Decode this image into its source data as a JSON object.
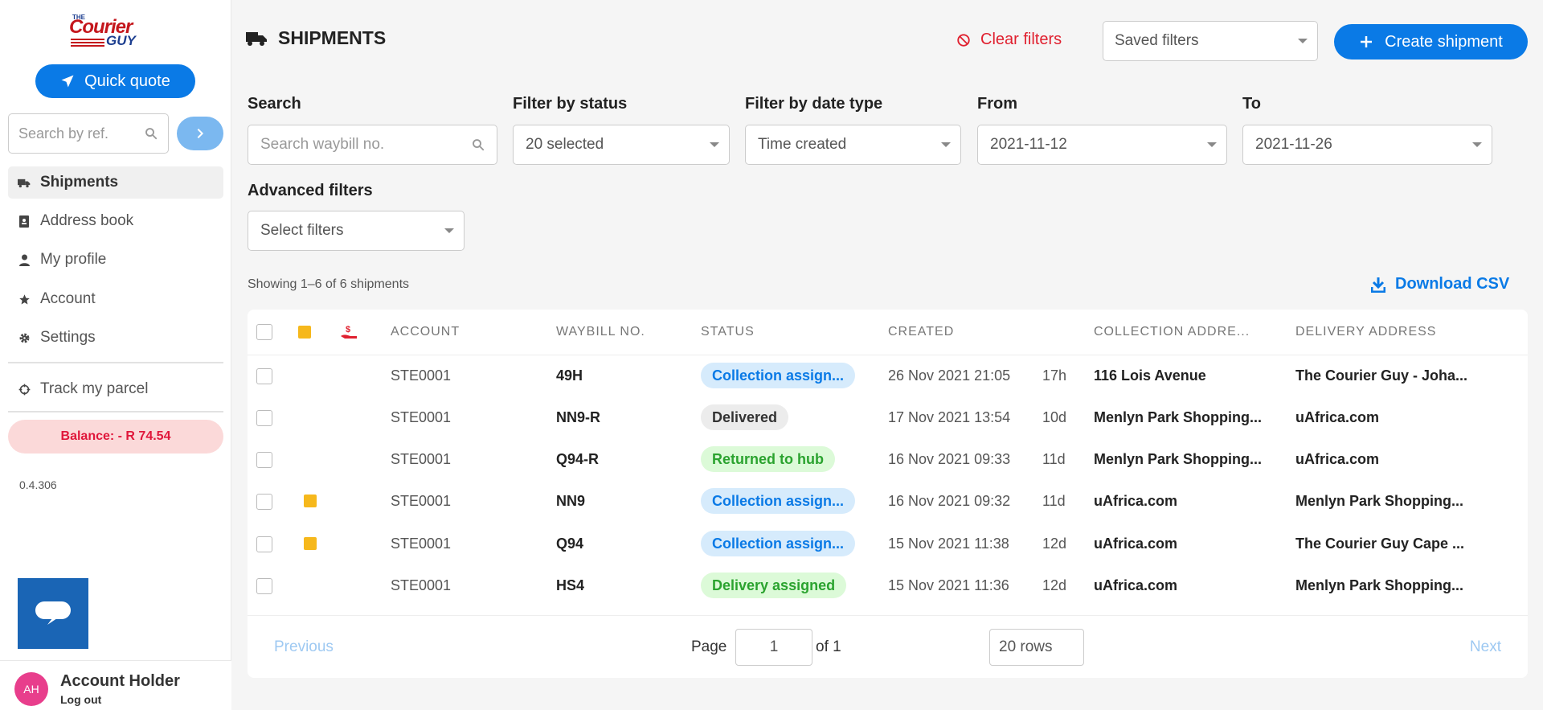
{
  "logo": {
    "the": "THE",
    "word1": "Courier",
    "word2": "GUY"
  },
  "sidebar": {
    "quick_quote": "Quick quote",
    "search_placeholder": "Search by ref.",
    "items": [
      {
        "label": "Shipments",
        "icon": "truck-icon"
      },
      {
        "label": "Address book",
        "icon": "address-book-icon"
      },
      {
        "label": "My profile",
        "icon": "user-icon"
      },
      {
        "label": "Account",
        "icon": "star-icon"
      },
      {
        "label": "Settings",
        "icon": "gear-icon"
      }
    ],
    "track": "Track my parcel",
    "balance": "Balance: - R 74.54",
    "version": "0.4.306",
    "user": {
      "initials": "AH",
      "name": "Account Holder",
      "logout": "Log out"
    }
  },
  "header": {
    "title": "SHIPMENTS",
    "clear_filters": "Clear filters",
    "saved_filters": "Saved filters",
    "create_shipment": "Create shipment"
  },
  "filters": {
    "search_label": "Search",
    "search_placeholder": "Search waybill no.",
    "status_label": "Filter by status",
    "status_value": "20 selected",
    "date_type_label": "Filter by date type",
    "date_type_value": "Time created",
    "from_label": "From",
    "from_value": "2021-11-12",
    "to_label": "To",
    "to_value": "2021-11-26",
    "advanced_label": "Advanced filters",
    "advanced_value": "Select filters"
  },
  "summary": {
    "showing": "Showing 1–6 of 6 shipments",
    "download_csv": "Download CSV"
  },
  "table": {
    "headers": {
      "account": "ACCOUNT",
      "waybill": "WAYBILL NO.",
      "status": "STATUS",
      "created": "CREATED",
      "collection": "COLLECTION ADDRE...",
      "delivery": "DELIVERY ADDRESS"
    },
    "rows": [
      {
        "note": false,
        "account": "STE0001",
        "waybill": "49H",
        "status": "Collection assign...",
        "status_style": "blue",
        "created": "26 Nov 2021 21:05",
        "age": "17h",
        "collection": "116 Lois Avenue",
        "delivery": "The Courier Guy - Joha..."
      },
      {
        "note": false,
        "account": "STE0001",
        "waybill": "NN9-R",
        "status": "Delivered",
        "status_style": "grey",
        "created": "17 Nov 2021 13:54",
        "age": "10d",
        "collection": "Menlyn Park Shopping...",
        "delivery": "uAfrica.com"
      },
      {
        "note": false,
        "account": "STE0001",
        "waybill": "Q94-R",
        "status": "Returned to hub",
        "status_style": "green",
        "created": "16 Nov 2021 09:33",
        "age": "11d",
        "collection": "Menlyn Park Shopping...",
        "delivery": "uAfrica.com"
      },
      {
        "note": true,
        "account": "STE0001",
        "waybill": "NN9",
        "status": "Collection assign...",
        "status_style": "blue",
        "created": "16 Nov 2021 09:32",
        "age": "11d",
        "collection": "uAfrica.com",
        "delivery": "Menlyn Park Shopping..."
      },
      {
        "note": true,
        "account": "STE0001",
        "waybill": "Q94",
        "status": "Collection assign...",
        "status_style": "blue",
        "created": "15 Nov 2021 11:38",
        "age": "12d",
        "collection": "uAfrica.com",
        "delivery": "The Courier Guy Cape ..."
      },
      {
        "note": false,
        "account": "STE0001",
        "waybill": "HS4",
        "status": "Delivery assigned",
        "status_style": "green",
        "created": "15 Nov 2021 11:36",
        "age": "12d",
        "collection": "uAfrica.com",
        "delivery": "Menlyn Park Shopping..."
      }
    ]
  },
  "pagination": {
    "previous": "Previous",
    "page_label": "Page",
    "page_value": "1",
    "of_label": "of 1",
    "rows": "20 rows",
    "next": "Next"
  },
  "colors": {
    "primary": "#0a7ae6",
    "danger": "#e0202f",
    "note": "#f6b81c"
  }
}
